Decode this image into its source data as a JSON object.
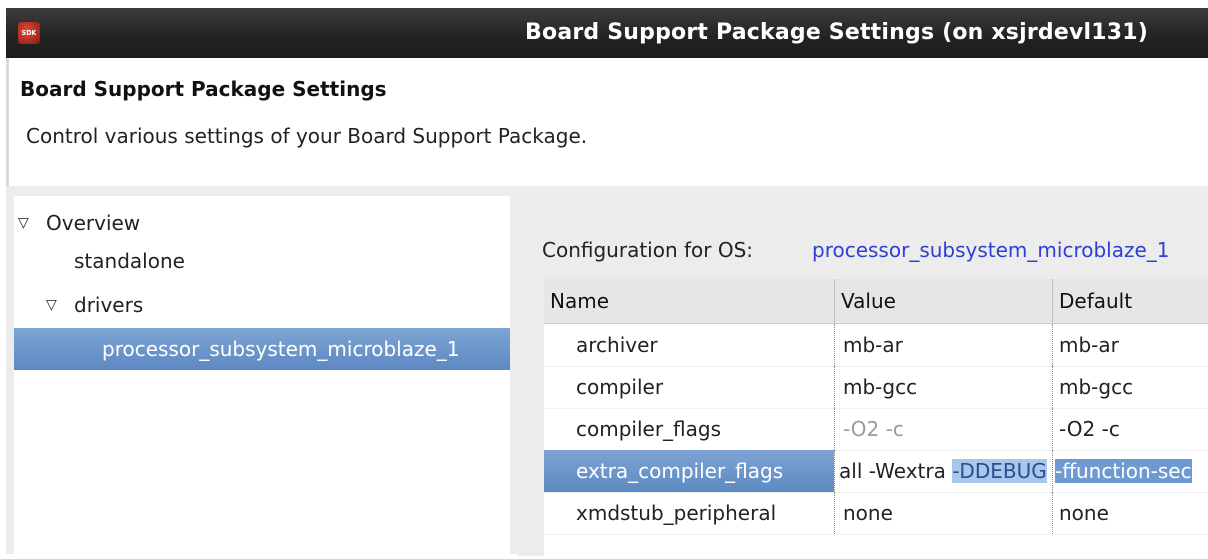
{
  "window": {
    "icon_label": "SDK",
    "title": "Board Support Package Settings  (on xsjrdevl131)"
  },
  "header": {
    "heading": "Board Support Package Settings",
    "description": "Control various settings of your Board Support Package."
  },
  "tree": {
    "overview": "Overview",
    "standalone": "standalone",
    "drivers": "drivers",
    "selected_item": "processor_subsystem_microblaze_1",
    "expand_glyph": "▽"
  },
  "config": {
    "label": "Configuration for OS:",
    "value": "processor_subsystem_microblaze_1"
  },
  "table": {
    "columns": [
      "Name",
      "Value",
      "Default"
    ],
    "rows": [
      {
        "name": "archiver",
        "value": "mb-ar",
        "default": "mb-ar"
      },
      {
        "name": "compiler",
        "value": "mb-gcc",
        "default": "mb-gcc"
      },
      {
        "name": "compiler_flags",
        "value": "-O2 -c",
        "default": "-O2 -c"
      },
      {
        "name": "extra_compiler_flags",
        "value_plain": "all -Wextra ",
        "value_highlight": "-DDEBUG",
        "default": "-ffunction-sec"
      },
      {
        "name": "xmdstub_peripheral",
        "value": "none",
        "default": "none"
      }
    ]
  },
  "colors": {
    "selection": "#6d96cb",
    "link": "#2e3ed6",
    "titlebar": "#2a2a2a"
  }
}
